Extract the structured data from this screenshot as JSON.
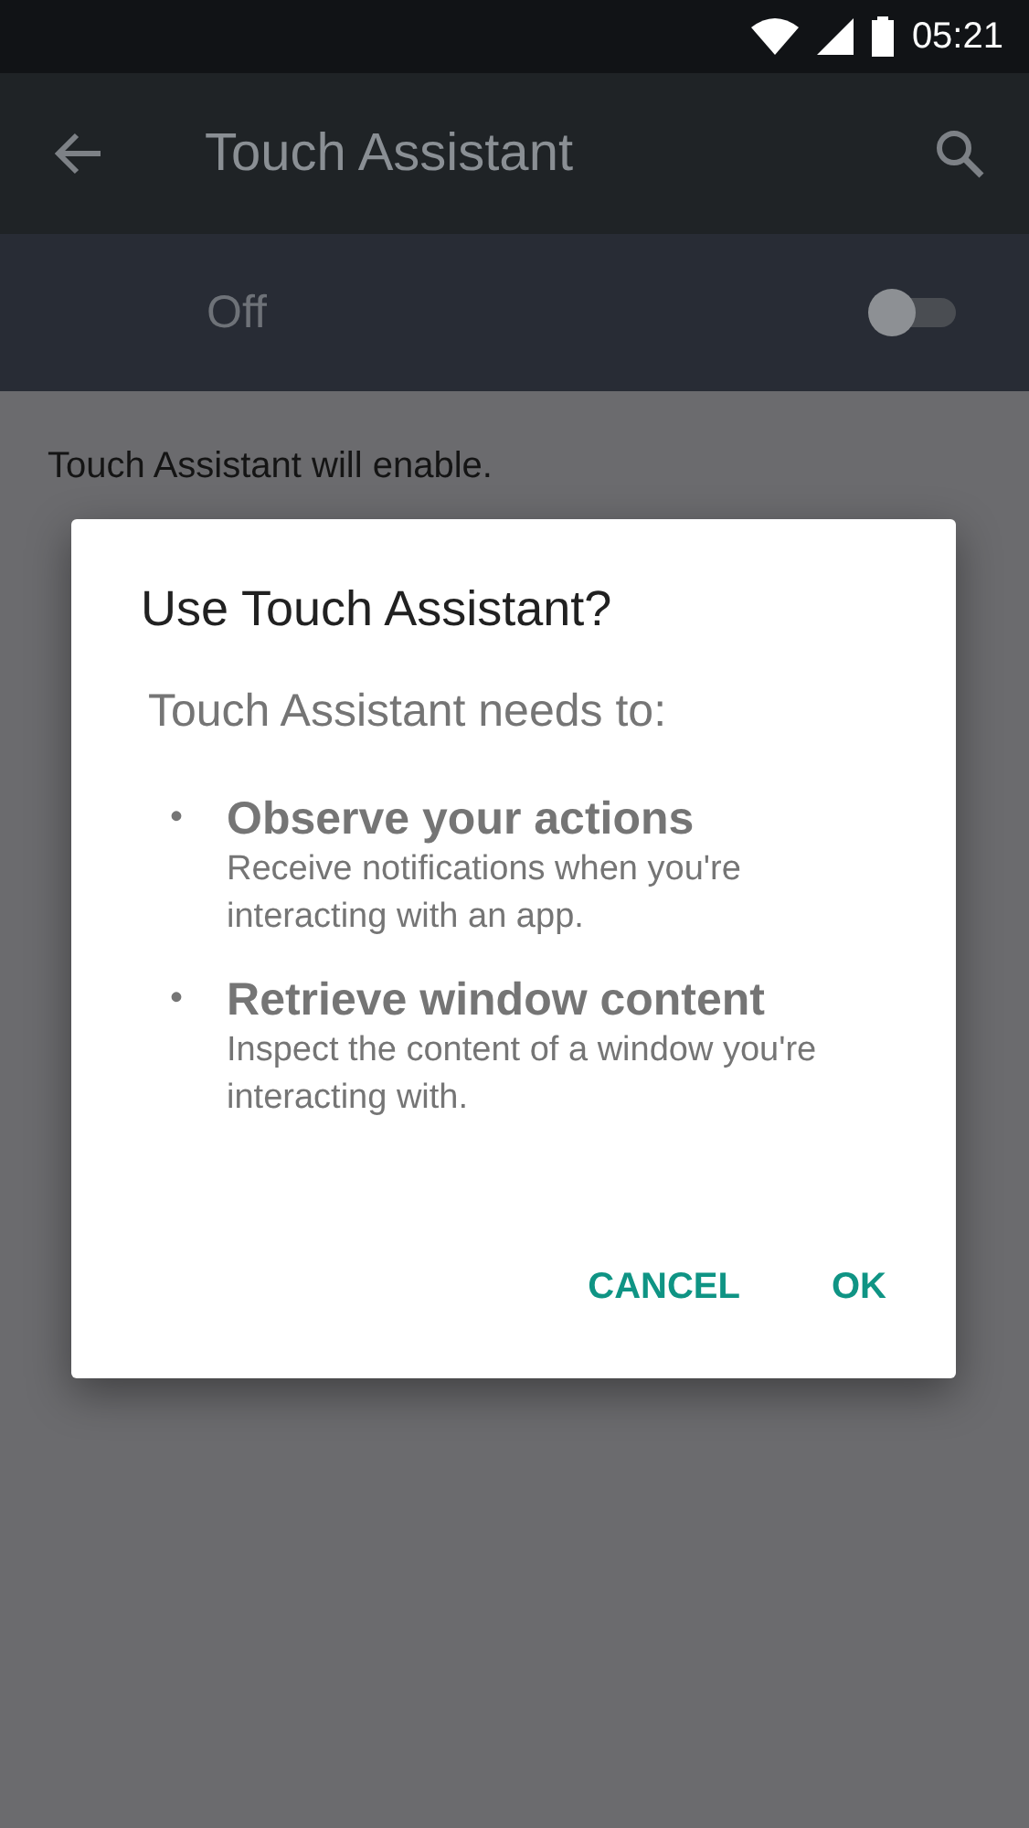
{
  "status_bar": {
    "time": "05:21"
  },
  "app_bar": {
    "title": "Touch Assistant"
  },
  "master_switch": {
    "label": "Off",
    "on": false
  },
  "description": "Touch Assistant will enable.",
  "dialog": {
    "title": "Use Touch Assistant?",
    "intro": "Touch Assistant needs to:",
    "items": [
      {
        "bullet": "•",
        "heading": "Observe your actions",
        "detail": "Receive notifications when you're interacting with an app."
      },
      {
        "bullet": "•",
        "heading": "Retrieve window content",
        "detail": "Inspect the content of a window you're interacting with."
      }
    ],
    "buttons": [
      "CANCEL",
      "OK"
    ]
  }
}
